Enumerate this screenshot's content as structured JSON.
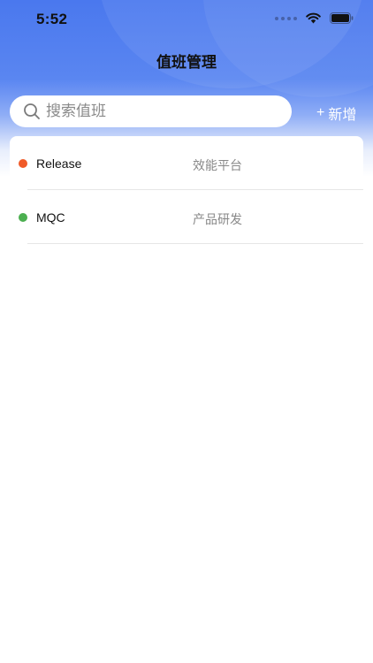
{
  "status_bar": {
    "time": "5:52"
  },
  "nav": {
    "title": "值班管理"
  },
  "search": {
    "placeholder": "搜索值班",
    "value": ""
  },
  "actions": {
    "add_plus": "+",
    "add_label": "新增"
  },
  "duty_list": [
    {
      "name": "Release",
      "team": "效能平台",
      "status_color": "#f05a28"
    },
    {
      "name": "MQC",
      "team": "产品研发",
      "status_color": "#4caf50"
    }
  ],
  "colors": {
    "brand_blue": "#4a78ee"
  }
}
